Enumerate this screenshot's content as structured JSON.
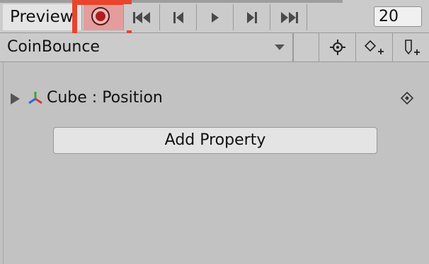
{
  "toolbar": {
    "preview_label": "Preview",
    "record_icon": "record-icon",
    "record_color": "#b01e1e",
    "record_active_bg": "#e39d9d",
    "highlight_color": "#e8452c",
    "buttons": [
      {
        "name": "first-keyframe-button",
        "icon": "skip-to-start-icon"
      },
      {
        "name": "previous-keyframe-button",
        "icon": "step-back-icon"
      },
      {
        "name": "play-button",
        "icon": "play-icon"
      },
      {
        "name": "next-keyframe-button",
        "icon": "step-forward-icon"
      },
      {
        "name": "last-keyframe-button",
        "icon": "skip-to-end-icon"
      }
    ],
    "frame_value": "20"
  },
  "clip_bar": {
    "clip_name": "CoinBounce",
    "buttons": [
      {
        "name": "filter-by-selection-button",
        "icon": "crosshair-icon"
      },
      {
        "name": "add-keyframe-button",
        "icon": "add-keyframe-icon"
      },
      {
        "name": "add-event-button",
        "icon": "add-event-icon"
      }
    ]
  },
  "properties": [
    {
      "label": "Cube : Position",
      "icon": "transform-axis-icon"
    }
  ],
  "add_property_label": "Add Property"
}
